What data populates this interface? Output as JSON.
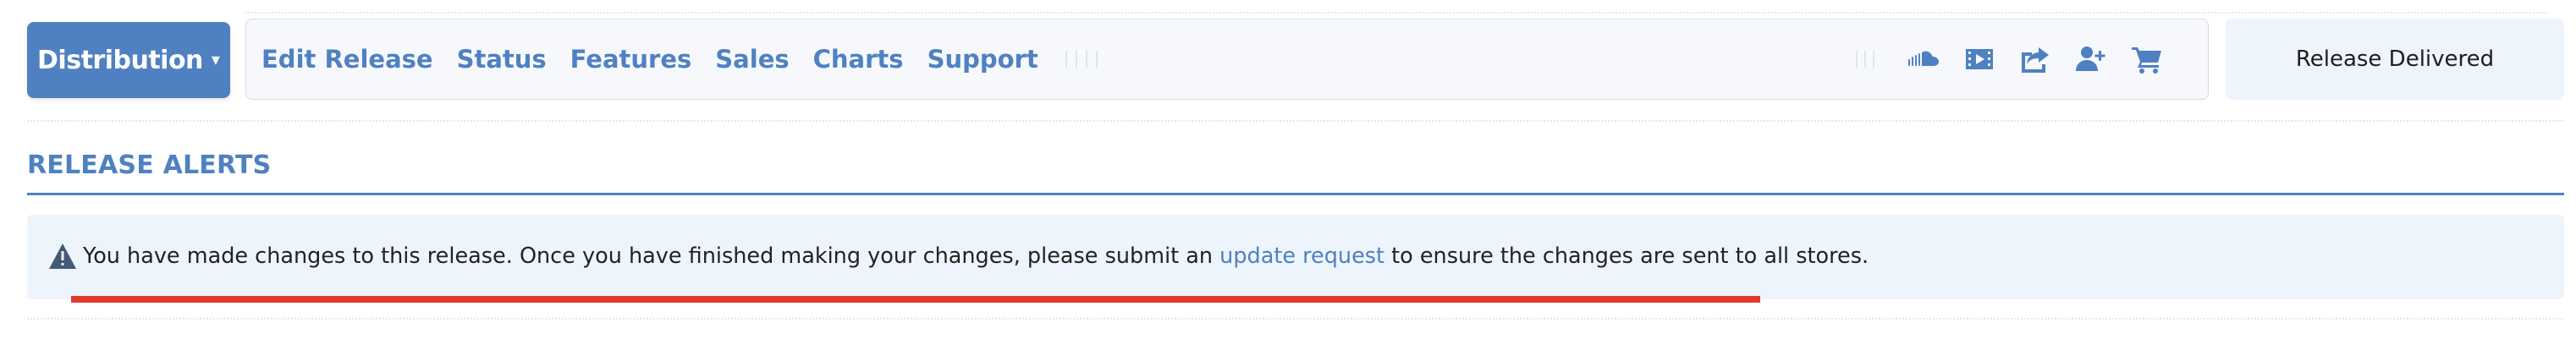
{
  "header": {
    "distribution_label": "Distribution",
    "nav": [
      {
        "label": "Edit Release"
      },
      {
        "label": "Status"
      },
      {
        "label": "Features"
      },
      {
        "label": "Sales"
      },
      {
        "label": "Charts"
      },
      {
        "label": "Support"
      }
    ],
    "icons": [
      {
        "name": "soundcloud-icon"
      },
      {
        "name": "video-icon"
      },
      {
        "name": "share-icon"
      },
      {
        "name": "add-user-icon"
      },
      {
        "name": "cart-icon"
      }
    ],
    "status_label": "Release Delivered"
  },
  "alerts": {
    "title": "RELEASE ALERTS",
    "message_before": "You have made changes to this release. Once you have finished making your changes, please submit an ",
    "link_text": "update request",
    "message_after": " to ensure the changes are sent to all stores."
  },
  "colors": {
    "accent": "#4f81c2",
    "alert_background": "#eef4fb",
    "highlight_underline": "#e23a2e"
  }
}
